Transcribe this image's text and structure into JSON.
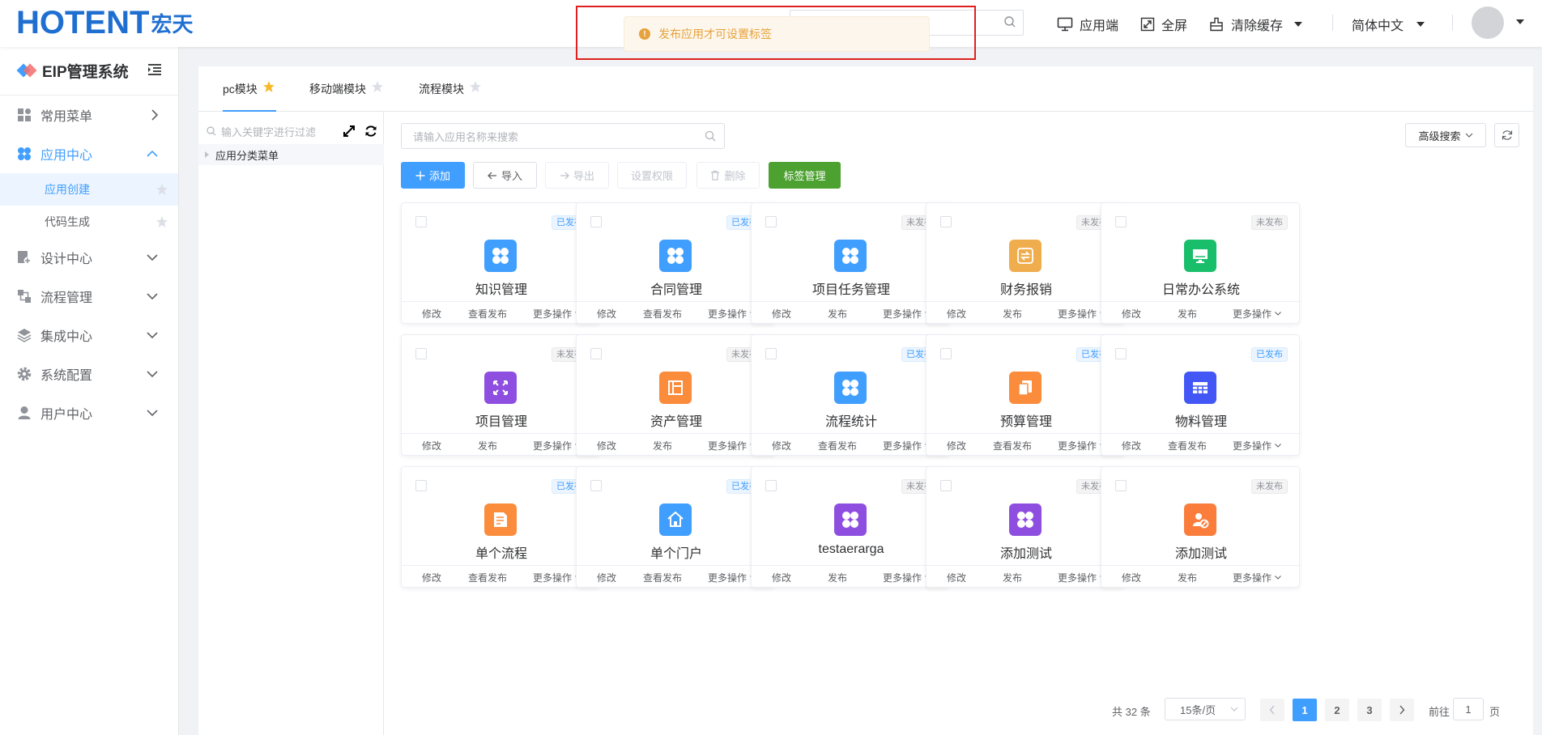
{
  "header": {
    "logo_text": "HOTENT",
    "logo_cn": "宏天",
    "search_placeholder": "",
    "app_end": "应用端",
    "fullscreen": "全屏",
    "clear_cache": "清除缓存",
    "language": "简体中文",
    "colors": {
      "logo": "#1f6fd1",
      "accent": "#409eff"
    }
  },
  "message": {
    "text": "发布应用才可设置标签",
    "type": "warning",
    "icon": "warning-circle-icon"
  },
  "sidebar": {
    "title": "EIP管理系统",
    "menus": [
      {
        "label": "常用菜单",
        "icon": "grid-icon",
        "arrow": "right"
      },
      {
        "label": "应用中心",
        "icon": "apps-icon",
        "arrow": "up",
        "active": true,
        "children": [
          {
            "label": "应用创建",
            "selected": true
          },
          {
            "label": "代码生成",
            "selected": false
          }
        ]
      },
      {
        "label": "设计中心",
        "icon": "design-icon",
        "arrow": "down"
      },
      {
        "label": "流程管理",
        "icon": "flow-icon",
        "arrow": "down"
      },
      {
        "label": "集成中心",
        "icon": "layers-icon",
        "arrow": "down"
      },
      {
        "label": "系统配置",
        "icon": "gear-icon",
        "arrow": "down"
      },
      {
        "label": "用户中心",
        "icon": "user-icon",
        "arrow": "down"
      }
    ]
  },
  "tabs": [
    {
      "label": "pc模块",
      "starred": true,
      "active": true
    },
    {
      "label": "移动端模块",
      "starred": false,
      "active": false
    },
    {
      "label": "流程模块",
      "starred": false,
      "active": false
    }
  ],
  "tree": {
    "filter_placeholder": "输入关键字进行过滤",
    "root": "应用分类菜单"
  },
  "toolbar": {
    "search_placeholder": "请输入应用名称来搜索",
    "advanced_search": "高级搜索",
    "add": "添加",
    "import": "导入",
    "export": "导出",
    "permissions": "设置权限",
    "delete": "删除",
    "tag_manage": "标签管理"
  },
  "apps": [
    {
      "name": "知识管理",
      "status": "已发布",
      "published": true,
      "icon": "clover-icon",
      "color": "#409eff",
      "actions": [
        "修改",
        "查看发布",
        "更多操作"
      ]
    },
    {
      "name": "合同管理",
      "status": "已发布",
      "published": true,
      "icon": "clover-icon",
      "color": "#409eff",
      "actions": [
        "修改",
        "查看发布",
        "更多操作"
      ]
    },
    {
      "name": "项目任务管理",
      "status": "未发布",
      "published": false,
      "icon": "clover-icon",
      "color": "#409eff",
      "actions": [
        "修改",
        "发布",
        "更多操作"
      ]
    },
    {
      "name": "财务报销",
      "status": "未发布",
      "published": false,
      "icon": "exchange-icon",
      "color": "#f0ad4e",
      "actions": [
        "修改",
        "发布",
        "更多操作"
      ]
    },
    {
      "name": "日常办公系统",
      "status": "未发布",
      "published": false,
      "icon": "monitor-icon",
      "color": "#19be6b",
      "actions": [
        "修改",
        "发布",
        "更多操作"
      ]
    },
    {
      "name": "项目管理",
      "status": "未发布",
      "published": false,
      "icon": "expand-icon",
      "color": "#8e4fe0",
      "actions": [
        "修改",
        "发布",
        "更多操作"
      ]
    },
    {
      "name": "资产管理",
      "status": "未发布",
      "published": false,
      "icon": "layout-icon",
      "color": "#fa8c3c",
      "actions": [
        "修改",
        "发布",
        "更多操作"
      ]
    },
    {
      "name": "流程统计",
      "status": "已发布",
      "published": true,
      "icon": "clover-icon",
      "color": "#409eff",
      "actions": [
        "修改",
        "查看发布",
        "更多操作"
      ]
    },
    {
      "name": "预算管理",
      "status": "已发布",
      "published": true,
      "icon": "copy-icon",
      "color": "#fa8c3c",
      "actions": [
        "修改",
        "查看发布",
        "更多操作"
      ]
    },
    {
      "name": "物料管理",
      "status": "已发布",
      "published": true,
      "icon": "table-icon",
      "color": "#4257f5",
      "actions": [
        "修改",
        "查看发布",
        "更多操作"
      ]
    },
    {
      "name": "单个流程",
      "status": "已发布",
      "published": true,
      "icon": "edit-doc-icon",
      "color": "#fa8c3c",
      "actions": [
        "修改",
        "查看发布",
        "更多操作"
      ]
    },
    {
      "name": "单个门户",
      "status": "已发布",
      "published": true,
      "icon": "home-icon",
      "color": "#409eff",
      "actions": [
        "修改",
        "查看发布",
        "更多操作"
      ]
    },
    {
      "name": "testaerarga",
      "status": "未发布",
      "published": false,
      "icon": "clover-icon",
      "color": "#8e4fe0",
      "actions": [
        "修改",
        "发布",
        "更多操作"
      ]
    },
    {
      "name": "添加测试",
      "status": "未发布",
      "published": false,
      "icon": "clover-icon",
      "color": "#8e4fe0",
      "actions": [
        "修改",
        "发布",
        "更多操作"
      ]
    },
    {
      "name": "添加测试",
      "status": "未发布",
      "published": false,
      "icon": "user-circle-icon",
      "color": "#fa7d3c",
      "actions": [
        "修改",
        "发布",
        "更多操作"
      ]
    }
  ],
  "pagination": {
    "total_text": "共 32 条",
    "page_size": "15条/页",
    "pages": [
      "1",
      "2",
      "3"
    ],
    "current": "1",
    "goto_label": "前往",
    "goto_value": "1",
    "unit": "页"
  }
}
